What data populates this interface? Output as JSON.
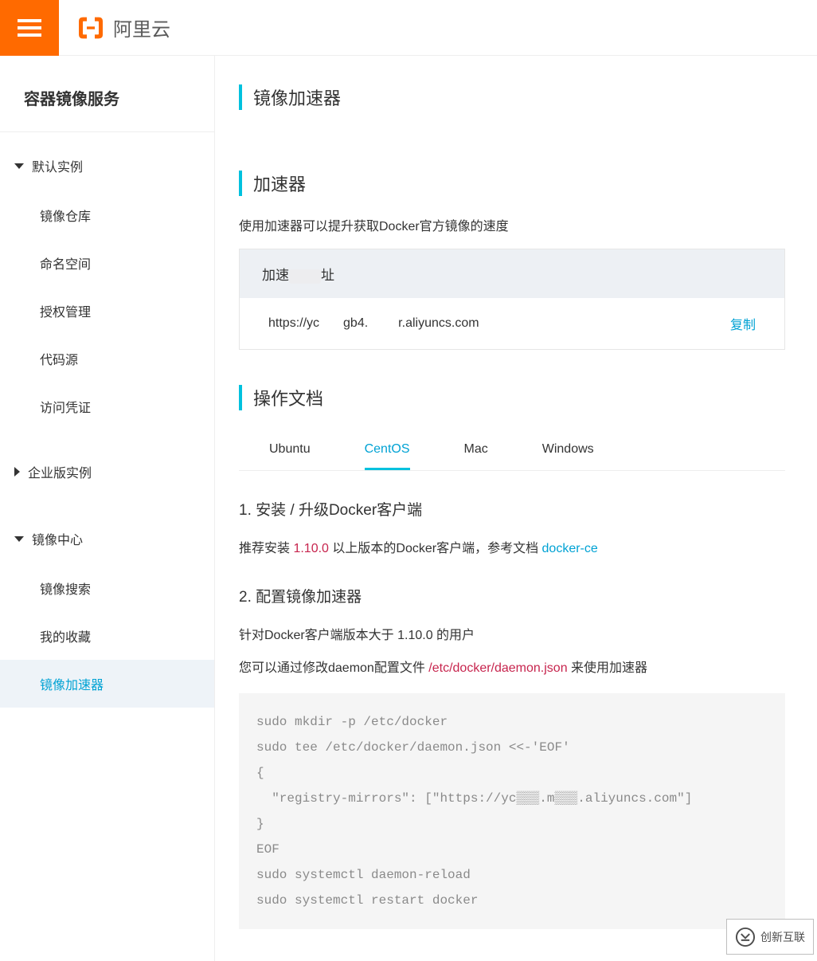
{
  "header": {
    "brand_name": "阿里云"
  },
  "sidebar": {
    "title": "容器镜像服务",
    "groups": [
      {
        "label": "默认实例",
        "expanded": true,
        "items": [
          {
            "label": "镜像仓库",
            "active": false
          },
          {
            "label": "命名空间",
            "active": false
          },
          {
            "label": "授权管理",
            "active": false
          },
          {
            "label": "代码源",
            "active": false
          },
          {
            "label": "访问凭证",
            "active": false
          }
        ]
      },
      {
        "label": "企业版实例",
        "expanded": false,
        "items": []
      },
      {
        "label": "镜像中心",
        "expanded": true,
        "items": [
          {
            "label": "镜像搜索",
            "active": false
          },
          {
            "label": "我的收藏",
            "active": false
          },
          {
            "label": "镜像加速器",
            "active": true
          }
        ]
      }
    ]
  },
  "page": {
    "title": "镜像加速器",
    "accelerator": {
      "heading": "加速器",
      "description": "使用加速器可以提升获取Docker官方镜像的速度",
      "addr_label_pre": "加速",
      "addr_label_post": "址",
      "url_pre": "https://yc",
      "url_mid": "gb4.",
      "url_post": "r.aliyuncs.com",
      "copy_label": "复制"
    },
    "docs": {
      "heading": "操作文档",
      "tabs": [
        "Ubuntu",
        "CentOS",
        "Mac",
        "Windows"
      ],
      "active_tab": 1,
      "sec1_title": "1. 安装 / 升级Docker客户端",
      "sec1_text_pre": "推荐安装 ",
      "sec1_version": "1.10.0",
      "sec1_text_mid": " 以上版本的Docker客户端，参考文档 ",
      "sec1_link": "docker-ce",
      "sec2_title": "2. 配置镜像加速器",
      "sec2_line1": "针对Docker客户端版本大于 1.10.0 的用户",
      "sec2_line2_pre": "您可以通过修改daemon配置文件 ",
      "sec2_file": "/etc/docker/daemon.json",
      "sec2_line2_post": " 来使用加速器",
      "code": "sudo mkdir -p /etc/docker\nsudo tee /etc/docker/daemon.json <<-'EOF'\n{\n  \"registry-mirrors\": [\"https://yc▒▒▒.m▒▒▒.aliyuncs.com\"]\n}\nEOF\nsudo systemctl daemon-reload\nsudo systemctl restart docker"
    }
  },
  "watermark": "创新互联"
}
